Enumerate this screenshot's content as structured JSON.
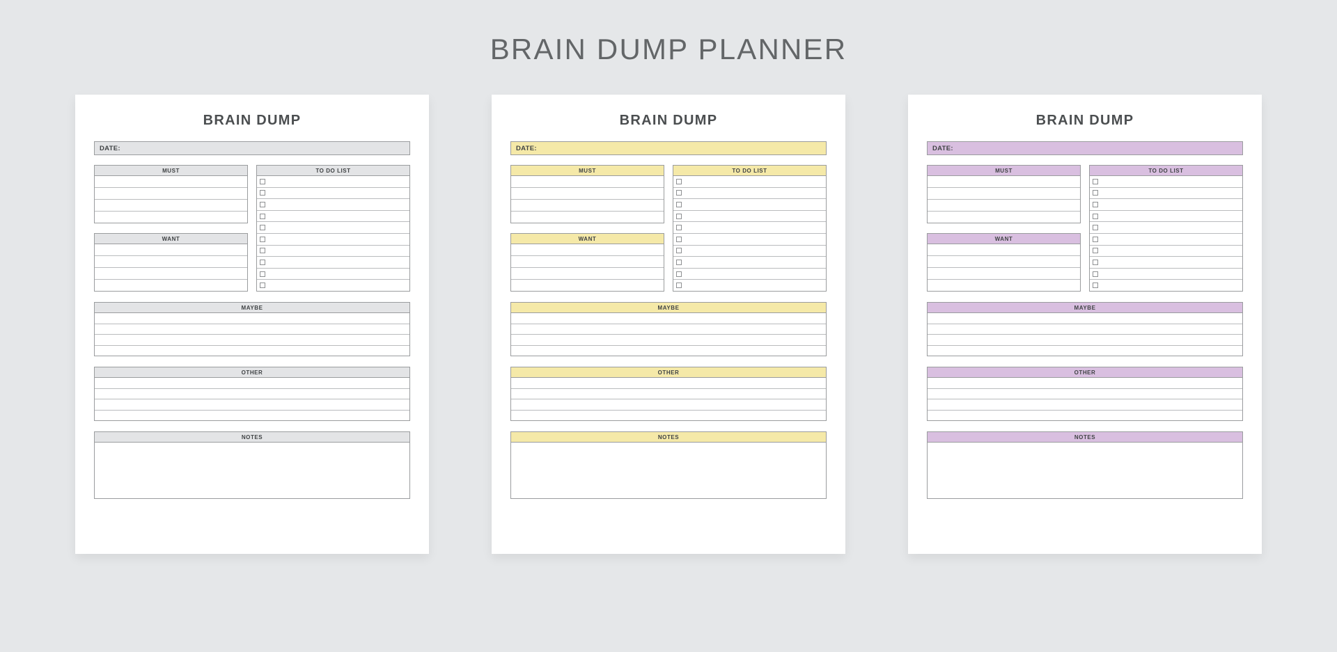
{
  "page": {
    "title": "BRAIN DUMP PLANNER",
    "background_color": "#e5e7e9",
    "title_color": "#636668"
  },
  "labels": {
    "card_title": "BRAIN DUMP",
    "date": "DATE:",
    "must": "MUST",
    "want": "WANT",
    "todo": "TO DO LIST",
    "maybe": "MAYBE",
    "other": "OTHER",
    "notes": "NOTES"
  },
  "structure": {
    "must_lines": 4,
    "want_lines": 4,
    "todo_checkbox_rows": 10,
    "maybe_lines": 4,
    "other_lines": 4,
    "notes_lines": 0
  },
  "cards": [
    {
      "variant": "gray",
      "accent_color": "#e3e4e6",
      "title": "BRAIN DUMP",
      "date": "DATE:",
      "must": "MUST",
      "want": "WANT",
      "todo": "TO DO LIST",
      "maybe": "MAYBE",
      "other": "OTHER",
      "notes": "NOTES"
    },
    {
      "variant": "yellow",
      "accent_color": "#f5e9a8",
      "title": "BRAIN DUMP",
      "date": "DATE:",
      "must": "MUST",
      "want": "WANT",
      "todo": "TO DO LIST",
      "maybe": "MAYBE",
      "other": "OTHER",
      "notes": "NOTES"
    },
    {
      "variant": "purple",
      "accent_color": "#d9bfe0",
      "title": "BRAIN DUMP",
      "date": "DATE:",
      "must": "MUST",
      "want": "WANT",
      "todo": "TO DO LIST",
      "maybe": "MAYBE",
      "other": "OTHER",
      "notes": "NOTES"
    }
  ]
}
